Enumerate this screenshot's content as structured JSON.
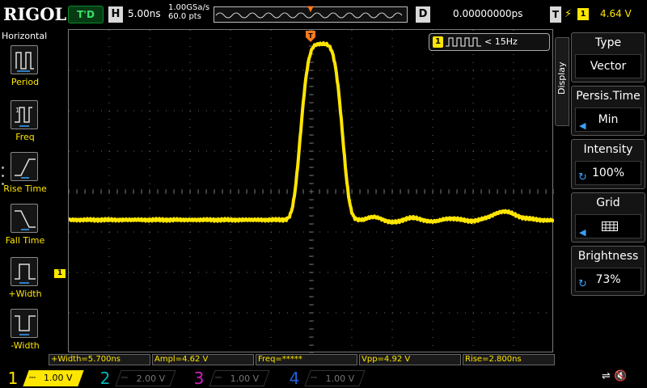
{
  "topbar": {
    "brand": "RIGOL",
    "status": "T'D",
    "horizontal_key": "H",
    "timebase": "5.00ns",
    "sample_rate": "1.00GSa/s",
    "memory_depth": "60.0 pts",
    "delay_key": "D",
    "delay": "0.00000000ps",
    "trigger_key": "T",
    "trigger_source": "1",
    "trigger_level": "4.64 V",
    "edge_icon": "rising-edge-icon",
    "trigger_marker": "T"
  },
  "left_menu": {
    "title": "Horizontal",
    "items": [
      {
        "label": "Period",
        "icon": "period-icon"
      },
      {
        "label": "Freq",
        "icon": "freq-icon"
      },
      {
        "label": "Rise Time",
        "icon": "rise-time-icon"
      },
      {
        "label": "Fall Time",
        "icon": "fall-time-icon"
      },
      {
        "label": "+Width",
        "icon": "positive-width-icon"
      },
      {
        "label": "-Width",
        "icon": "negative-width-icon"
      }
    ]
  },
  "screen": {
    "channel_marker": "1",
    "trigger_marker": "T",
    "freq_counter": {
      "channel": "1",
      "text": "< 15Hz"
    }
  },
  "waveform": {
    "channel": "1",
    "color": "#ffe600",
    "baseline_div": -0.7,
    "peak_div": 3.65,
    "peak_time_div": 0.25
  },
  "right_menu": {
    "tab": "Display",
    "items": [
      {
        "title": "Type",
        "value": "Vector",
        "control": "none"
      },
      {
        "title": "Persis.Time",
        "value": "Min",
        "control": "arrow"
      },
      {
        "title": "Intensity",
        "value": "100%",
        "control": "knob"
      },
      {
        "title": "Grid",
        "value": "",
        "control": "arrow",
        "value_icon": "grid-icon"
      },
      {
        "title": "Brightness",
        "value": "73%",
        "control": "knob"
      }
    ]
  },
  "measurements": [
    "+Width=5.700ns",
    "Ampl=4.62 V",
    "Freq=*****",
    "Vpp=4.92 V",
    "Rise=2.800ns"
  ],
  "channels": [
    {
      "num": "1",
      "scale": "1.00 V",
      "coupling_icon": "dc-coupling-icon",
      "color": "#ffe600",
      "active": true
    },
    {
      "num": "2",
      "scale": "2.00 V",
      "coupling_icon": "dc-coupling-icon",
      "color": "#00b8b8",
      "active": false
    },
    {
      "num": "3",
      "scale": "1.00 V",
      "coupling_icon": "dc-coupling-icon",
      "color": "#d020c0",
      "active": false
    },
    {
      "num": "4",
      "scale": "1.00 V",
      "coupling_icon": "dc-coupling-icon",
      "color": "#2060e0",
      "active": false
    }
  ],
  "bottom_icons": [
    "usb-icon",
    "speaker-mute-icon"
  ]
}
